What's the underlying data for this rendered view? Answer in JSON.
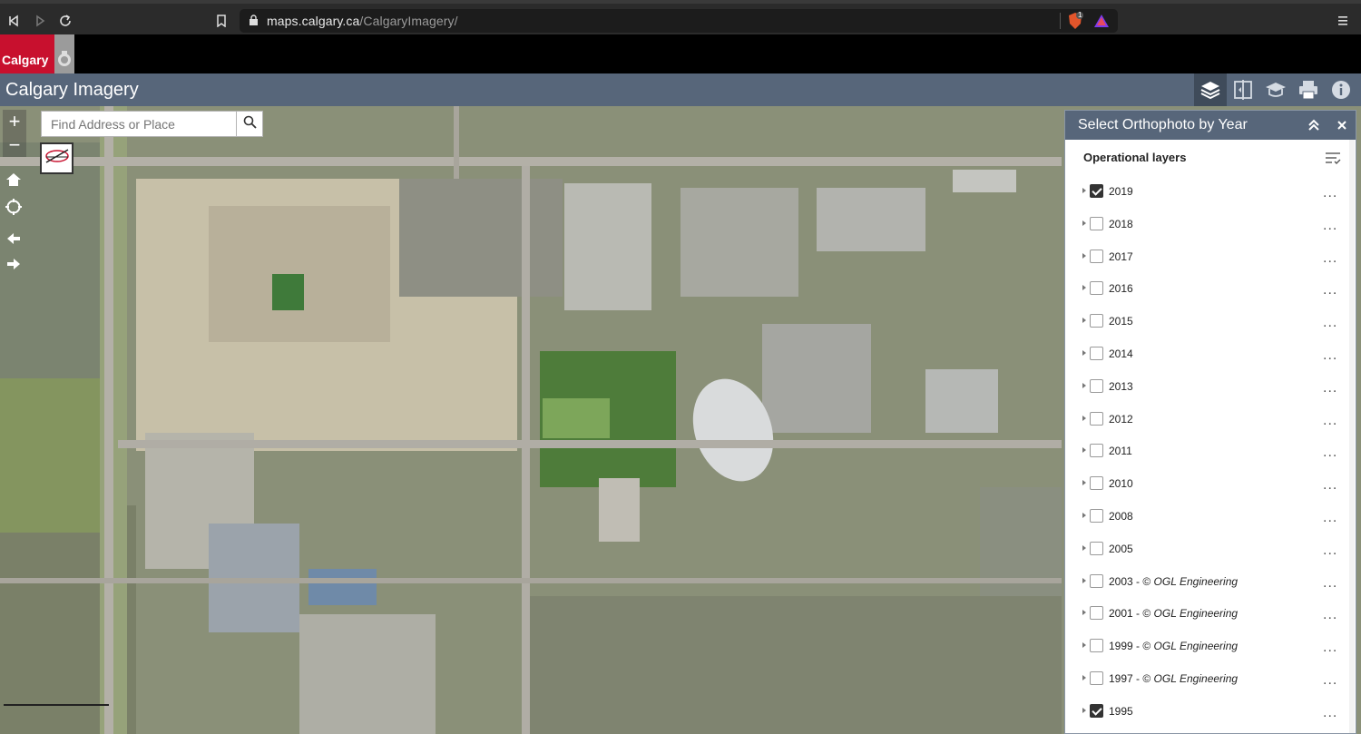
{
  "browser": {
    "url_domain": "maps.calgary.ca",
    "url_path": "/CalgaryImagery/",
    "brave_badge": "1"
  },
  "logo": {
    "text": "Calgary"
  },
  "app": {
    "title": "Calgary Imagery",
    "tools": [
      "layers-icon",
      "swipe-icon",
      "tutorial-icon",
      "print-icon",
      "info-icon"
    ]
  },
  "map": {
    "search": {
      "placeholder": "Find Address or Place"
    },
    "zoom_in": "+",
    "zoom_out": "−"
  },
  "panel": {
    "title": "Select Orthophoto by Year",
    "section_label": "Operational layers",
    "layers": [
      {
        "year": "2019",
        "credit": "",
        "checked": true
      },
      {
        "year": "2018",
        "credit": "",
        "checked": false
      },
      {
        "year": "2017",
        "credit": "",
        "checked": false
      },
      {
        "year": "2016",
        "credit": "",
        "checked": false
      },
      {
        "year": "2015",
        "credit": "",
        "checked": false
      },
      {
        "year": "2014",
        "credit": "",
        "checked": false
      },
      {
        "year": "2013",
        "credit": "",
        "checked": false
      },
      {
        "year": "2012",
        "credit": "",
        "checked": false
      },
      {
        "year": "2011",
        "credit": "",
        "checked": false
      },
      {
        "year": "2010",
        "credit": "",
        "checked": false
      },
      {
        "year": "2008",
        "credit": "",
        "checked": false
      },
      {
        "year": "2005",
        "credit": "",
        "checked": false
      },
      {
        "year": "2003 - © ",
        "credit": "OGL Engineering",
        "checked": false
      },
      {
        "year": "2001 - © ",
        "credit": "OGL Engineering",
        "checked": false
      },
      {
        "year": "1999 - © ",
        "credit": "OGL Engineering",
        "checked": false
      },
      {
        "year": "1997 - © ",
        "credit": "OGL Engineering",
        "checked": false
      },
      {
        "year": "1995",
        "credit": "",
        "checked": true
      }
    ],
    "more_label": "..."
  }
}
